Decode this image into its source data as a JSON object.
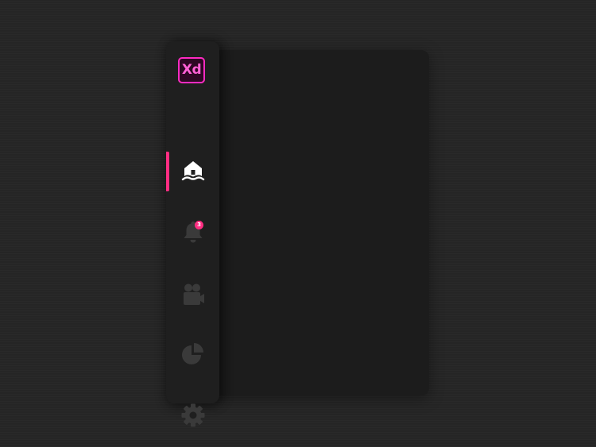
{
  "app": {
    "logo_text": "Xd",
    "accent_color": "#ff2d82",
    "logo_color": "#ff2bc2"
  },
  "sidebar": {
    "items": [
      {
        "id": "home",
        "icon": "home-icon",
        "active": true
      },
      {
        "id": "notifications",
        "icon": "bell-icon",
        "badge": "3",
        "active": false
      },
      {
        "id": "video",
        "icon": "video-camera-icon",
        "active": false
      },
      {
        "id": "stats",
        "icon": "pie-chart-icon",
        "active": false
      },
      {
        "id": "settings",
        "icon": "gear-icon",
        "active": false
      }
    ]
  }
}
